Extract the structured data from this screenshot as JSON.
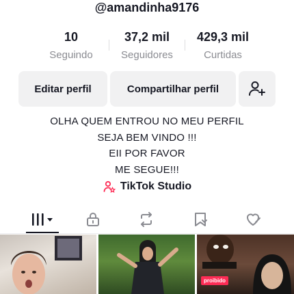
{
  "profile": {
    "username": "@amandinha9176"
  },
  "stats": [
    {
      "value": "10",
      "label": "Seguindo"
    },
    {
      "value": "37,2 mil",
      "label": "Seguidores"
    },
    {
      "value": "429,3 mil",
      "label": "Curtidas"
    }
  ],
  "actions": {
    "edit_label": "Editar perfil",
    "share_label": "Compartilhar perfil",
    "add_friend_icon": "add-user-icon"
  },
  "bio": {
    "lines": [
      "OLHA QUEM ENTROU NO MEU PERFIL",
      "SEJA BEM VINDO !!!",
      "EII POR FAVOR",
      "ME SEGUE!!!"
    ]
  },
  "studio": {
    "label": "TikTok Studio",
    "icon": "studio-person-icon",
    "accent": "#fe2c55"
  },
  "tabs": [
    {
      "icon": "videos-grid-icon",
      "active": true
    },
    {
      "icon": "lock-icon"
    },
    {
      "icon": "repost-icon"
    },
    {
      "icon": "saved-bookmark-icon"
    },
    {
      "icon": "liked-heart-icon"
    }
  ],
  "grid": {
    "tiles": [
      {
        "thumbnail": "girl-selfie-video"
      },
      {
        "thumbnail": "girl-dancing-forest-video"
      },
      {
        "thumbnail": "reaction-video",
        "badge": "proibido"
      }
    ]
  }
}
